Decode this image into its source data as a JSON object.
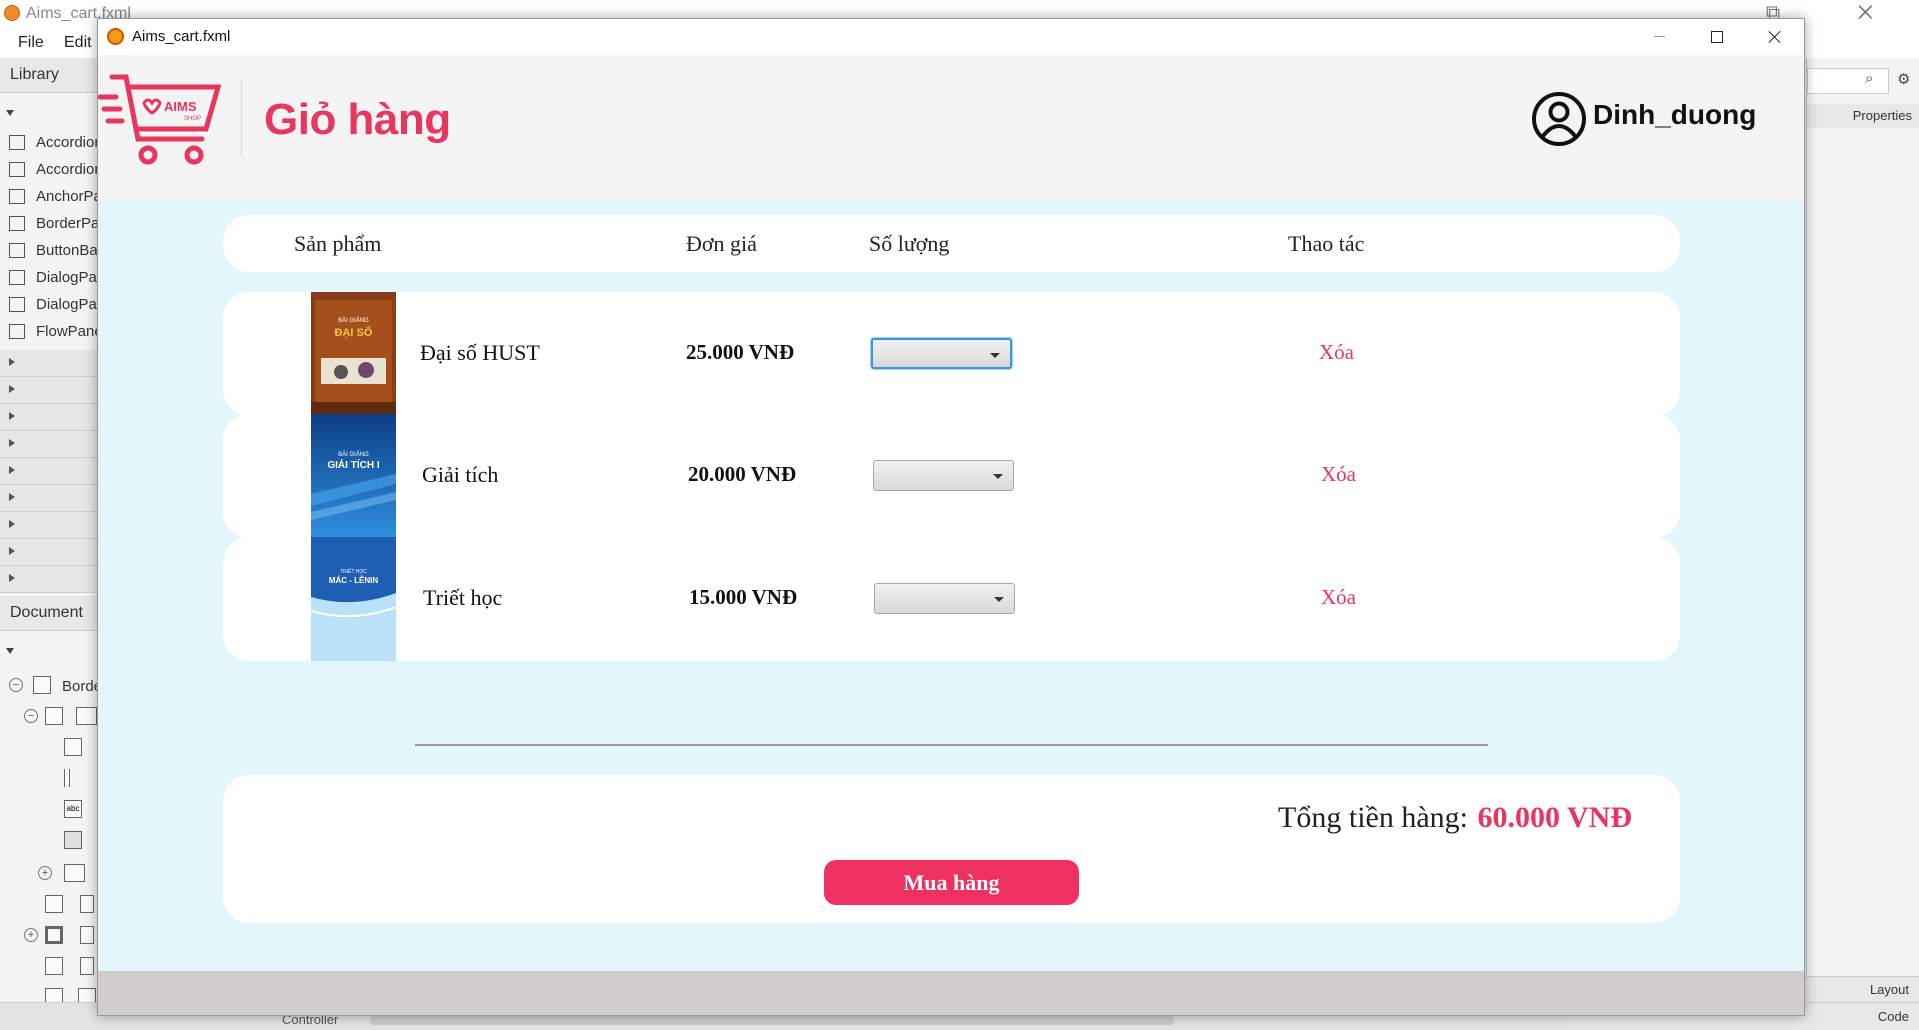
{
  "background_app": {
    "title": "Aims_cart.fxml",
    "menu": [
      "File",
      "Edit"
    ],
    "library_label": "Library",
    "library_items": [
      "Accordion",
      "Accordion",
      "AnchorPane",
      "BorderPane",
      "ButtonBar",
      "DialogPane",
      "DialogPane",
      "FlowPane"
    ],
    "document_label": "Document",
    "tree_root": "BorderPane",
    "properties_label": "Properties",
    "layout_label": "Layout",
    "code_label": "Code",
    "controller_label": "Controller"
  },
  "window": {
    "title": "Aims_cart.fxml"
  },
  "header": {
    "logo_text": "AIMS",
    "logo_subtext": "SHOP",
    "page_title": "Giỏ hàng",
    "username": "Dinh_duong"
  },
  "table_header": {
    "product": "Sản phẩm",
    "unit_price": "Đơn giá",
    "quantity": "Số lượng",
    "action": "Thao tác"
  },
  "cart_items": [
    {
      "name": "Đại số HUST",
      "price": "25.000 VNĐ",
      "quantity": "",
      "action": "Xóa",
      "cover_title": "ĐẠI SỐ",
      "cover_top": "BÀI GIẢNG",
      "cover_color": "#8a3e17"
    },
    {
      "name": "Giải tích",
      "price": "20.000 VNĐ",
      "quantity": "",
      "action": "Xóa",
      "cover_title": "GIẢI TÍCH I",
      "cover_top": "BÀI GIẢNG",
      "cover_color": "#1a62b0"
    },
    {
      "name": "Triết học",
      "price": "15.000 VNĐ",
      "quantity": "",
      "action": "Xóa",
      "cover_title": "MÁC - LÊNIN",
      "cover_top": "TRIẾT HỌC",
      "cover_color": "#1f5fb3"
    }
  ],
  "summary": {
    "total_label": "Tổng tiền hàng:",
    "total_value": "60.000 VNĐ",
    "buy_button": "Mua hàng"
  },
  "colors": {
    "accent": "#e8365f",
    "content_bg": "#e2f6fc",
    "header_bg": "#f4f4f4",
    "footer_bg": "#d0cdcd"
  }
}
